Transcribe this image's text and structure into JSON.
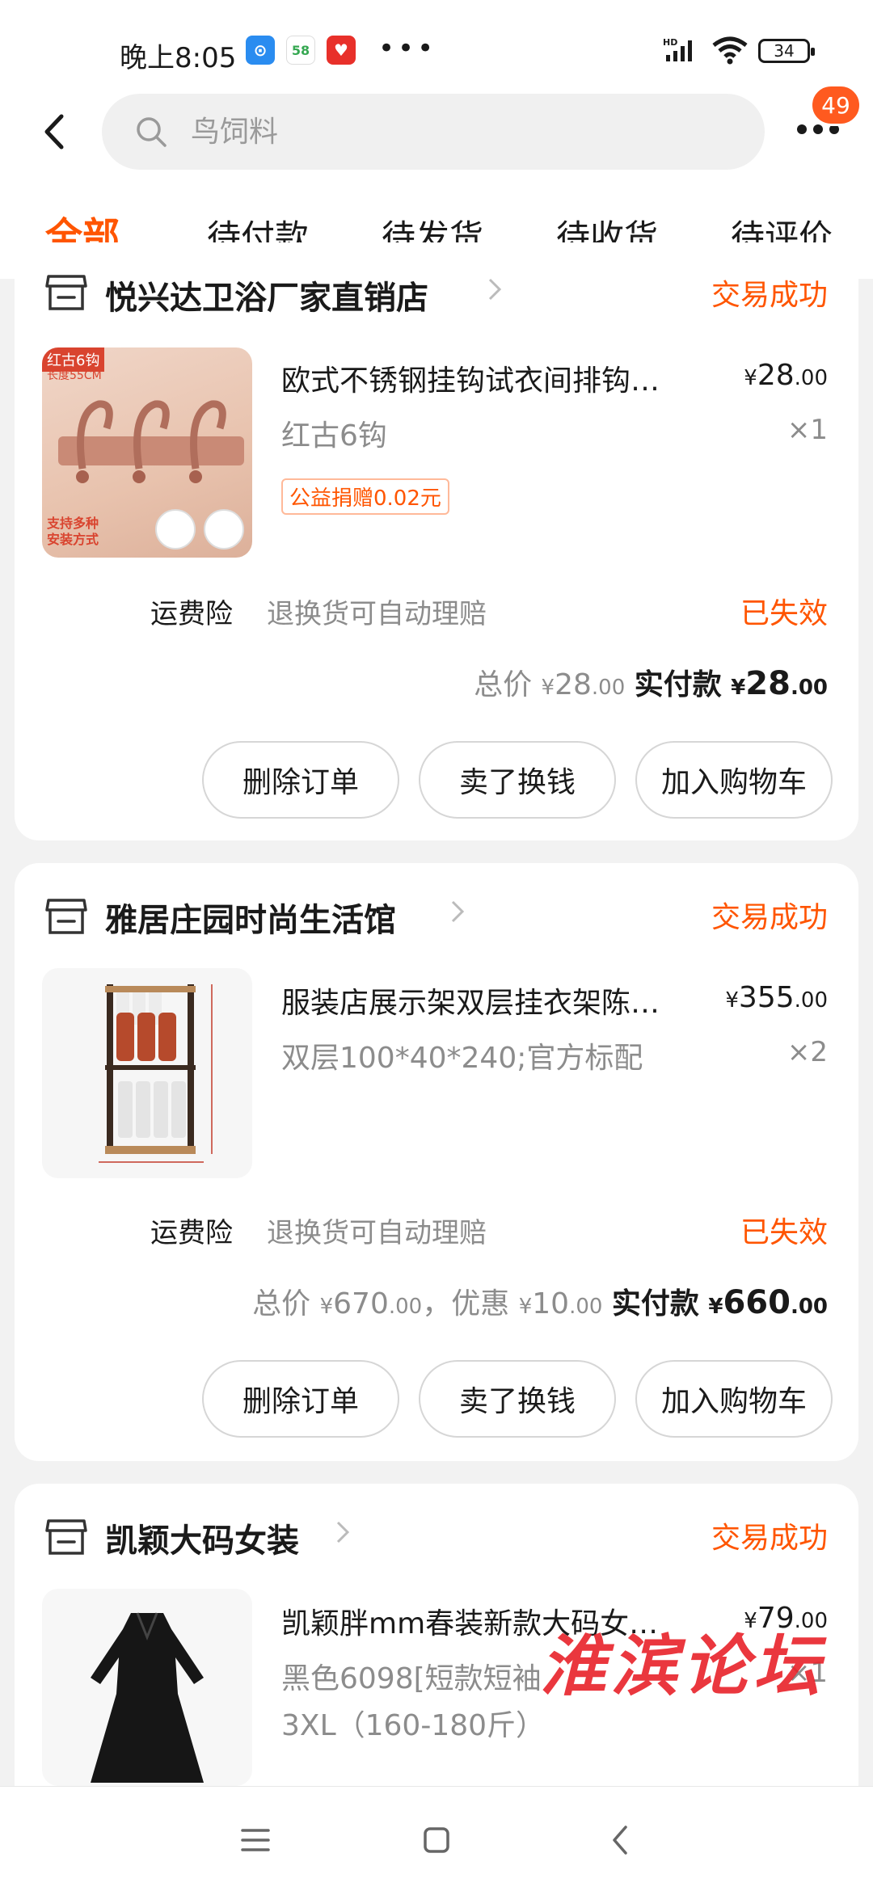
{
  "status_bar": {
    "time": "晚上8:05",
    "battery": "34",
    "signal": "HD"
  },
  "header": {
    "search_placeholder": "鸟饲料",
    "badge_count": "49"
  },
  "tabs": [
    "全部",
    "待付款",
    "待发货",
    "待收货",
    "待评价"
  ],
  "orders": [
    {
      "shop": "悦兴达卫浴厂家直销店",
      "status": "交易成功",
      "item_title": "欧式不锈钢挂钩试衣间排钩…",
      "price_yen": "¥",
      "price_int": "28",
      "price_dec": ".00",
      "sku": "红古6钩",
      "qty": "×1",
      "charity": "公益捐赠0.02元",
      "insurance_label": "运费险",
      "insurance_desc": "退换货可自动理赔",
      "insurance_state": "已失效",
      "total_label": "总价",
      "total_int": "28",
      "total_dec": ".00",
      "paid_label": "实付款",
      "paid_int": "28",
      "paid_dec": ".00",
      "buttons": [
        "删除订单",
        "卖了换钱",
        "加入购物车"
      ],
      "thumb_text": [
        "红古6钩",
        "长度55CM",
        "支持多种",
        "安装方式"
      ]
    },
    {
      "shop": "雅居庄园时尚生活馆",
      "status": "交易成功",
      "item_title": "服装店展示架双层挂衣架陈…",
      "price_yen": "¥",
      "price_int": "355",
      "price_dec": ".00",
      "sku": "双层100*40*240;官方标配",
      "qty": "×2",
      "insurance_label": "运费险",
      "insurance_desc": "退换货可自动理赔",
      "insurance_state": "已失效",
      "total_label": "总价",
      "total_int": "670",
      "total_dec": ".00",
      "discount_label": "优惠",
      "discount_int": "10",
      "discount_dec": ".00",
      "paid_label": "实付款",
      "paid_int": "660",
      "paid_dec": ".00",
      "buttons": [
        "删除订单",
        "卖了换钱",
        "加入购物车"
      ]
    },
    {
      "shop": "凯颖大码女装",
      "status": "交易成功",
      "item_title": "凯颖胖mm春装新款大码女…",
      "price_yen": "¥",
      "price_int": "79",
      "price_dec": ".00",
      "sku_line1": "黑色6098[短款短袖",
      "sku_line2": "3XL（160-180斤）",
      "qty": "×1"
    }
  ],
  "watermark": "淮滨论坛",
  "colors": {
    "accent": "#ff5500",
    "badge": "#ff5a1f",
    "background": "#f2f2f2"
  }
}
